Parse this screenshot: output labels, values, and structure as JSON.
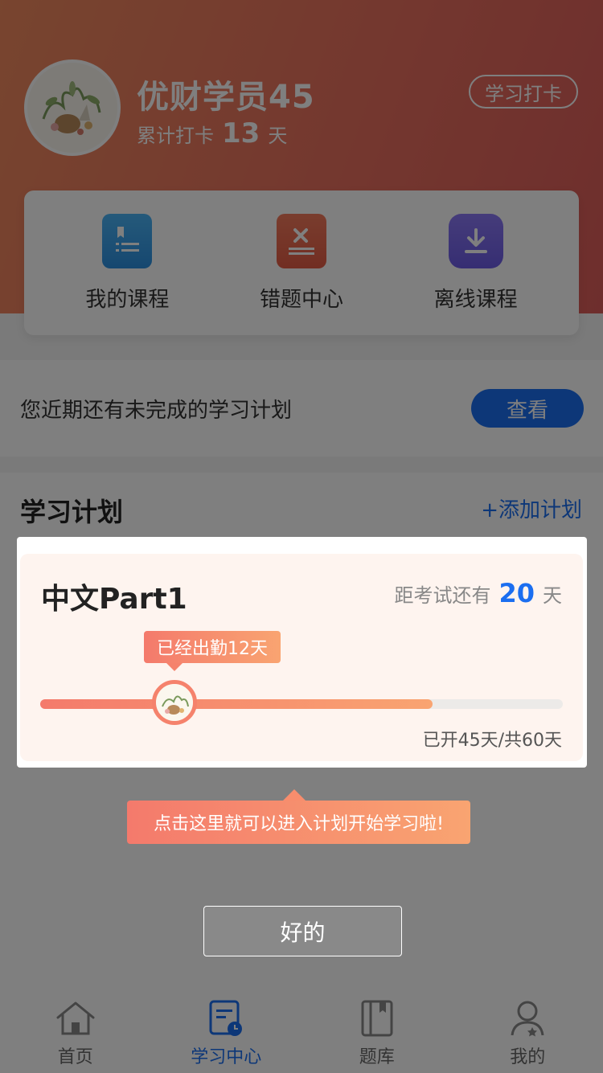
{
  "profile": {
    "username": "优财学员45",
    "checkin_prefix": "累计打卡",
    "checkin_days": "13",
    "checkin_suffix": "天",
    "checkin_button": "学习打卡"
  },
  "quick_links": [
    {
      "label": "我的课程",
      "icon": "book-list-icon"
    },
    {
      "label": "错题中心",
      "icon": "wrong-question-book-icon"
    },
    {
      "label": "离线课程",
      "icon": "download-icon"
    }
  ],
  "notice": {
    "text": "您近期还有未完成的学习计划",
    "button": "查看"
  },
  "plan_section": {
    "title": "学习计划",
    "add_button": "+添加计划"
  },
  "plan_card": {
    "course_name": "中文Part1",
    "exam_prefix": "距考试还有",
    "exam_days": "20",
    "exam_suffix": "天",
    "attendance_tip": "已经出勤12天",
    "progress": {
      "elapsed_days": 45,
      "total_days": 60,
      "attended_days": 12,
      "text": "已开45天/共60天"
    }
  },
  "guide": {
    "tip": "点击这里就可以进入计划开始学习啦!",
    "ok_button": "好的"
  },
  "tabbar": [
    {
      "label": "首页",
      "icon": "home-icon",
      "active": false
    },
    {
      "label": "学习中心",
      "icon": "study-center-icon",
      "active": true
    },
    {
      "label": "题库",
      "icon": "question-bank-icon",
      "active": false
    },
    {
      "label": "我的",
      "icon": "profile-icon",
      "active": false
    }
  ],
  "colors": {
    "header_start": "#f08a5f",
    "header_end": "#dd5d5a",
    "accent_blue": "#1b6ef0",
    "progress_start": "#f47a6c",
    "progress_end": "#f9a471"
  }
}
